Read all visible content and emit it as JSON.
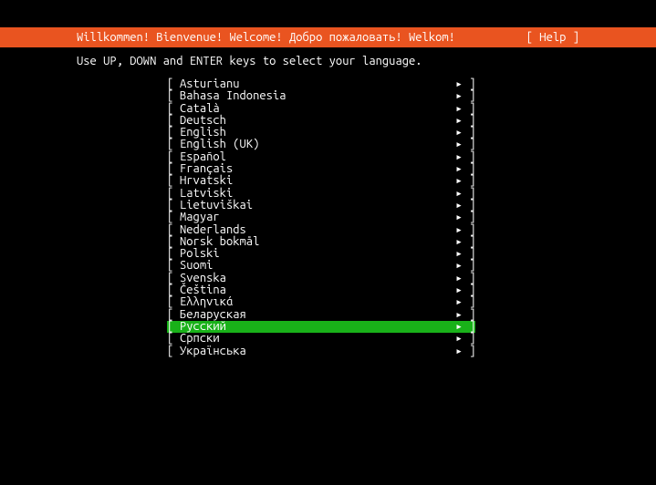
{
  "header": {
    "title": "Willkommen! Bienvenue! Welcome! Добро пожаловать! Welkom!",
    "help": "[ Help ]"
  },
  "instruction": "Use UP, DOWN and ENTER keys to select your language.",
  "bracket_open": "[",
  "bracket_close": "]",
  "arrow": "▸",
  "selected_index": 20,
  "languages": [
    "Asturianu",
    "Bahasa Indonesia",
    "Català",
    "Deutsch",
    "English",
    "English (UK)",
    "Español",
    "Français",
    "Hrvatski",
    "Latviski",
    "Lietuviškai",
    "Magyar",
    "Nederlands",
    "Norsk bokmål",
    "Polski",
    "Suomi",
    "Svenska",
    "Čeština",
    "Ελληνικά",
    "Беларуская",
    "Русский",
    "Српски",
    "Українська"
  ]
}
